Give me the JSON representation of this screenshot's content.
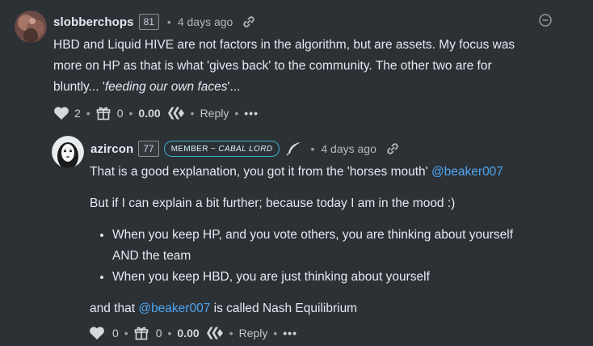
{
  "comments": [
    {
      "author": "slobberchops",
      "reputation": "81",
      "time": "4 days ago",
      "body": {
        "line1": "HBD and Liquid HIVE are not factors in the algorithm, but are assets. My focus was",
        "line2": "more on HP as that is what 'gives back' to the community. The other two are for",
        "line3_pre": "bluntly... '",
        "line3_em": "feeding our own faces",
        "line3_post": "'..."
      },
      "actions": {
        "votes": "2",
        "reblogs": "0",
        "payout": "0.00",
        "reply_label": "Reply",
        "more_label": "•••"
      }
    },
    {
      "author": "azircon",
      "reputation": "77",
      "badge_part1": "MEMBER",
      "badge_part2": "~ CABAL LORD",
      "time": "4 days ago",
      "body": {
        "p1_text": "That is a good explanation, you got it from the 'horses mouth' ",
        "p1_mention": "@beaker007",
        "p2": "But if I can explain a bit further; because today I am in the mood :)",
        "bullet1_line1": "When you keep HP, and you vote others, you are thinking about yourself",
        "bullet1_line2": "AND the team",
        "bullet2": "When you keep HBD, you are just thinking about yourself",
        "p3_pre": "and that ",
        "p3_mention": "@beaker007",
        "p3_post": " is called Nash Equilibrium"
      },
      "actions": {
        "votes": "0",
        "reblogs": "0",
        "payout": "0.00",
        "reply_label": "Reply",
        "more_label": "•••"
      }
    }
  ],
  "colors": {
    "background": "#2c3136",
    "text": "#e7e7f1",
    "mention": "#4fa6f0",
    "badge_border": "#3ab3c8"
  }
}
